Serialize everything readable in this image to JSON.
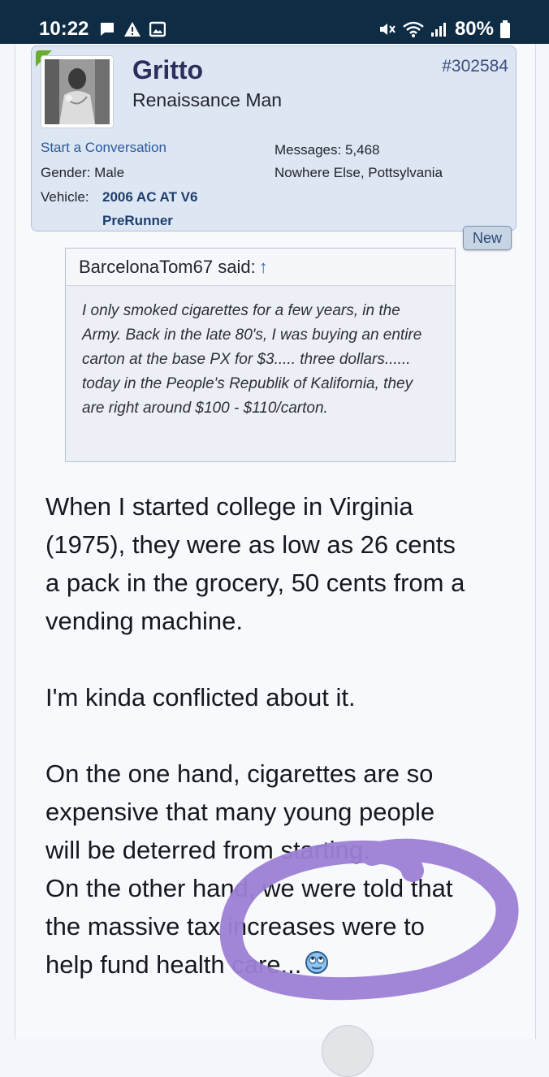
{
  "status_bar": {
    "time": "10:22",
    "battery": "80%",
    "left_icons": [
      "chat-icon",
      "warning-icon",
      "image-icon"
    ],
    "right_icons": [
      "mute-icon",
      "wifi-icon",
      "signal-icon",
      "battery-icon"
    ]
  },
  "post": {
    "username": "Gritto",
    "user_title": "Renaissance Man",
    "post_number": "#302584",
    "start_conversation": "Start a Conversation",
    "gender_label": "Gender:",
    "gender_value": "Male",
    "vehicle_label": "Vehicle:",
    "vehicle_line1": "2006 AC AT V6",
    "vehicle_line2": "PreRunner",
    "messages_label": "Messages:",
    "messages_value": "5,468",
    "location": "Nowhere Else, Pottsylvania",
    "new_badge": "New",
    "accent_color": "#6aad2f"
  },
  "quote": {
    "author_said": "BarcelonaTom67 said:",
    "arrow": "↑",
    "text": "I only smoked cigarettes for a few years, in the Army. Back in the late 80's, I was buying an entire carton at the base PX for $3..... three dollars...... today in the People's Republik of Kalifornia, they are right around $100 - $110/carton."
  },
  "message": {
    "para1": "When I started college in Virginia (1975), they were as low as 26 cents a pack in the grocery, 50 cents from a vending machine.",
    "para2": "I'm kinda conflicted about it.",
    "para3a": "On the one hand, cigarettes are so expensive that many young people will be deterred from starting.",
    "para3b": "On the other hand, we were told that the massive tax increases were to help fund health care...",
    "smiley": "rolling-eyes-smiley-icon"
  },
  "annotation": {
    "color": "#9c7fd6"
  }
}
